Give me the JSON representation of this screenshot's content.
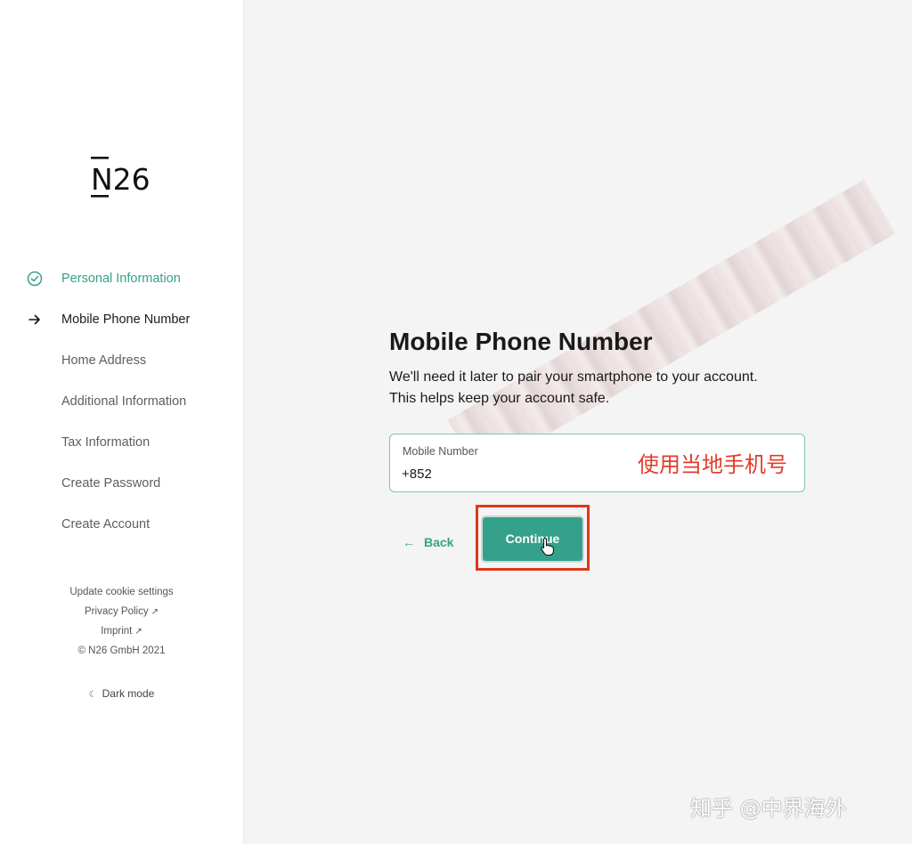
{
  "sidebar": {
    "logo_text": "N26",
    "steps": [
      {
        "label": "Personal Information",
        "state": "done"
      },
      {
        "label": "Mobile Phone Number",
        "state": "current"
      },
      {
        "label": "Home Address",
        "state": "upcoming"
      },
      {
        "label": "Additional Information",
        "state": "upcoming"
      },
      {
        "label": "Tax Information",
        "state": "upcoming"
      },
      {
        "label": "Create Password",
        "state": "upcoming"
      },
      {
        "label": "Create Account",
        "state": "upcoming"
      }
    ],
    "footer": {
      "cookie_settings": "Update cookie settings",
      "privacy_policy": "Privacy Policy",
      "imprint": "Imprint",
      "copyright": "© N26 GmbH 2021"
    },
    "dark_mode_label": "Dark mode"
  },
  "main": {
    "title": "Mobile Phone Number",
    "subtitle_line1": "We'll need it later to pair your smartphone to your account.",
    "subtitle_line2": "This helps keep your account safe.",
    "phone_field": {
      "label": "Mobile Number",
      "value": "+852"
    },
    "annotation": "使用当地手机号",
    "back_label": "Back",
    "continue_label": "Continue"
  },
  "watermark": "知乎 @中界海外",
  "colors": {
    "accent": "#36a18b",
    "highlight_red": "#e0361c",
    "annotation_red": "#e23c2e"
  },
  "icons": {
    "done_step": "check-circle-icon",
    "current_step": "arrow-right-icon",
    "external_link": "external-link-icon",
    "dark_mode": "moon-icon",
    "back": "arrow-left-icon",
    "cursor": "hand-pointer-icon"
  }
}
